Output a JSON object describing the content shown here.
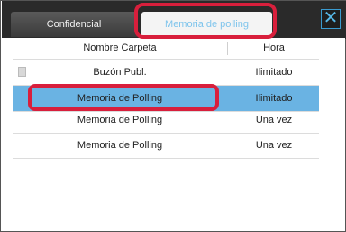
{
  "tabs": {
    "confidential": "Confidencial",
    "polling": "Memoria de polling"
  },
  "close_icon": "close-icon",
  "table": {
    "headers": {
      "name": "Nombre Carpeta",
      "time": "Hora"
    },
    "rows": [
      {
        "name": "Buzón Publ.",
        "time": "Ilimitado"
      },
      {
        "name": "Memoria de Polling",
        "time": "Ilimitado"
      },
      {
        "name": "Memoria de Polling",
        "time": "Una vez"
      },
      {
        "name": "Memoria de Polling",
        "time": "Una vez"
      }
    ]
  },
  "colors": {
    "highlight": "#d81f3c",
    "selected_row": "#6ab3e3",
    "accent": "#56b7e6"
  }
}
